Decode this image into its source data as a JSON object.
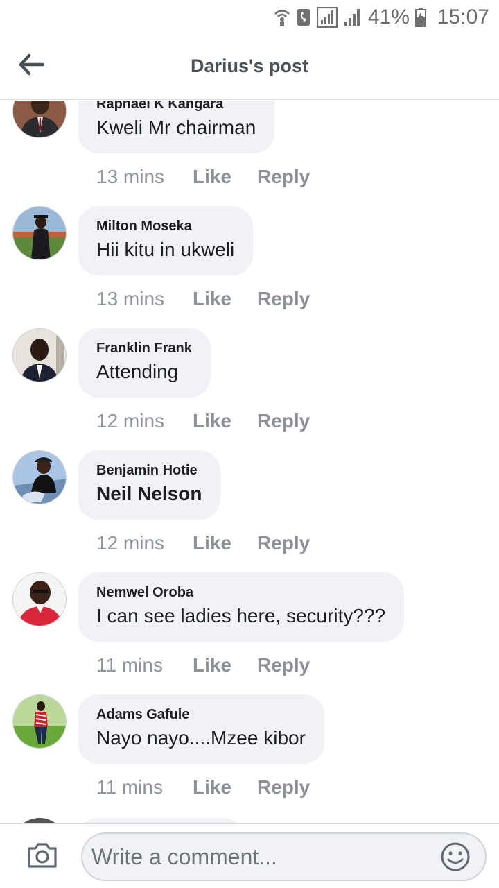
{
  "status_bar": {
    "battery_percent": "41%",
    "time": "15:07",
    "icons": [
      "wifi-calling-icon",
      "phone-icon",
      "signal-icon",
      "signal-icon",
      "battery-charging-icon"
    ]
  },
  "header": {
    "title": "Darius's post",
    "back_icon": "arrow-left-icon"
  },
  "comments": [
    {
      "name": "Raphael K Kangara",
      "text": "Kweli Mr chairman",
      "time": "13 mins",
      "like": "Like",
      "reply": "Reply"
    },
    {
      "name": "Milton Moseka",
      "text": "Hii kitu in ukweli",
      "time": "13 mins",
      "like": "Like",
      "reply": "Reply"
    },
    {
      "name": "Franklin Frank",
      "text": "Attending",
      "time": "12 mins",
      "like": "Like",
      "reply": "Reply"
    },
    {
      "name": "Benjamin Hotie",
      "text": "Neil Nelson",
      "time": "12 mins",
      "like": "Like",
      "reply": "Reply"
    },
    {
      "name": "Nemwel Oroba",
      "text": "I can see ladies here, security???",
      "time": "11 mins",
      "like": "Like",
      "reply": "Reply"
    },
    {
      "name": "Adams Gafule",
      "text": "Nayo nayo....Mzee kibor",
      "time": "11 mins",
      "like": "Like",
      "reply": "Reply"
    }
  ],
  "composer": {
    "placeholder": "Write a comment...",
    "camera_icon": "camera-icon",
    "emoji_icon": "smiley-icon"
  },
  "colors": {
    "bubble": "#f0f2f5",
    "secondary_text": "#90949c",
    "title_text": "#4b4f56"
  }
}
